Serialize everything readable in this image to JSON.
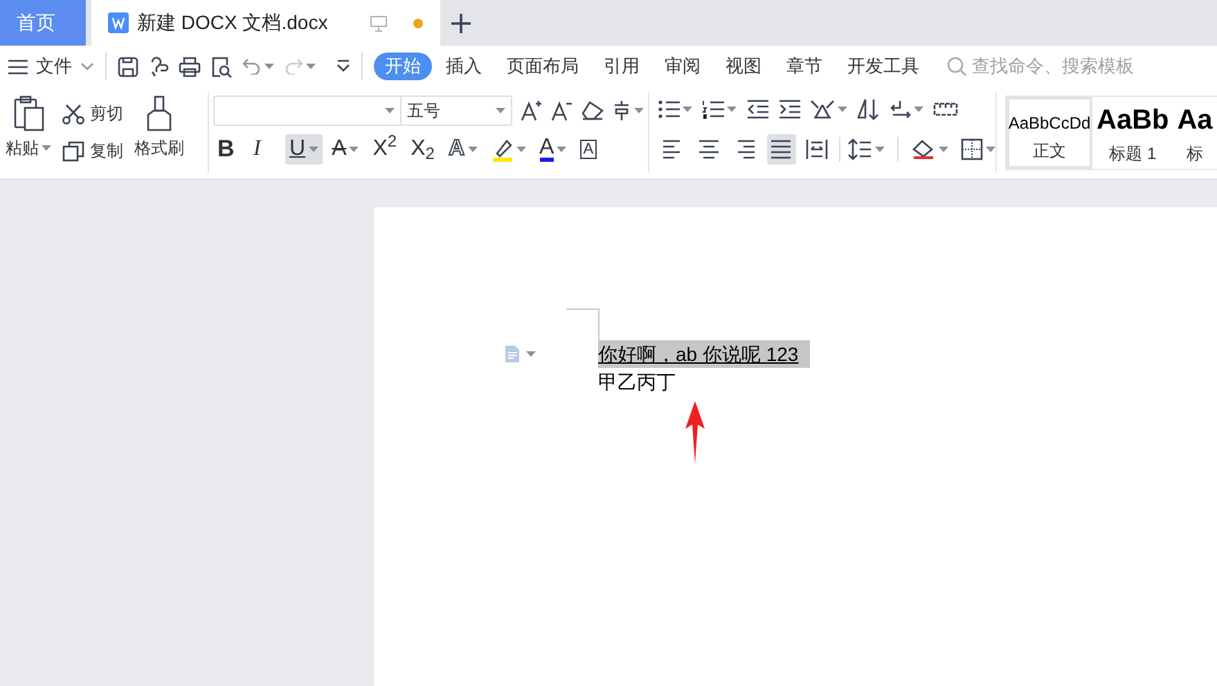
{
  "tabs": [
    {
      "label": "首页",
      "kind": "home",
      "selected": false
    },
    {
      "label": "新建 DOCX 文档.docx",
      "kind": "document",
      "selected": true,
      "unsaved": true
    }
  ],
  "menu": {
    "file_label": "文件"
  },
  "ribbon_tabs": [
    {
      "label": "开始",
      "selected": true
    },
    {
      "label": "插入",
      "selected": false
    },
    {
      "label": "页面布局",
      "selected": false
    },
    {
      "label": "引用",
      "selected": false
    },
    {
      "label": "审阅",
      "selected": false
    },
    {
      "label": "视图",
      "selected": false
    },
    {
      "label": "章节",
      "selected": false
    },
    {
      "label": "开发工具",
      "selected": false
    }
  ],
  "search": {
    "placeholder": "查找命令、搜索模板"
  },
  "clipboard": {
    "paste": "粘贴",
    "cut": "剪切",
    "copy": "复制",
    "format_painter": "格式刷"
  },
  "font": {
    "size": "五号",
    "format_buttons": [
      {
        "glyph": "B",
        "kind": "bold",
        "active": false
      },
      {
        "glyph": "I",
        "kind": "italic",
        "active": false
      },
      {
        "glyph": "U",
        "kind": "underline",
        "active": true
      },
      {
        "glyph": "A",
        "kind": "strike",
        "active": false
      },
      {
        "glyph": "X$^{2}$",
        "kind": "plain",
        "active": false
      },
      {
        "glyph": "X$_{2}$",
        "kind": "plain",
        "active": false
      },
      {
        "glyph": "A",
        "kind": "outline",
        "active": false
      },
      {
        "kind": "highlight",
        "active": false
      },
      {
        "glyph": "A",
        "kind": "color",
        "active": false
      },
      {
        "glyph": "A",
        "kind": "boxed",
        "active": false
      }
    ]
  },
  "paragraph": {
    "align": [
      {
        "kind": "left",
        "active": false
      },
      {
        "kind": "center",
        "active": false
      },
      {
        "kind": "right",
        "active": false
      },
      {
        "kind": "justify",
        "active": true
      },
      {
        "kind": "distributed",
        "active": false
      }
    ]
  },
  "styles": [
    {
      "sample": "AaBbCcDd",
      "label": "正文",
      "kind": "body",
      "selected": true
    },
    {
      "sample": "AaBb",
      "label": "标题 1",
      "kind": "heading",
      "selected": false
    },
    {
      "sample": "Aa",
      "label": "标",
      "kind": "heading",
      "selected": false
    }
  ],
  "document": {
    "lines": [
      {
        "text": "你好啊，ab 你说呢 123",
        "selected": true,
        "underline": true
      },
      {
        "text": "甲乙丙丁",
        "selected": false,
        "underline": false
      }
    ]
  }
}
